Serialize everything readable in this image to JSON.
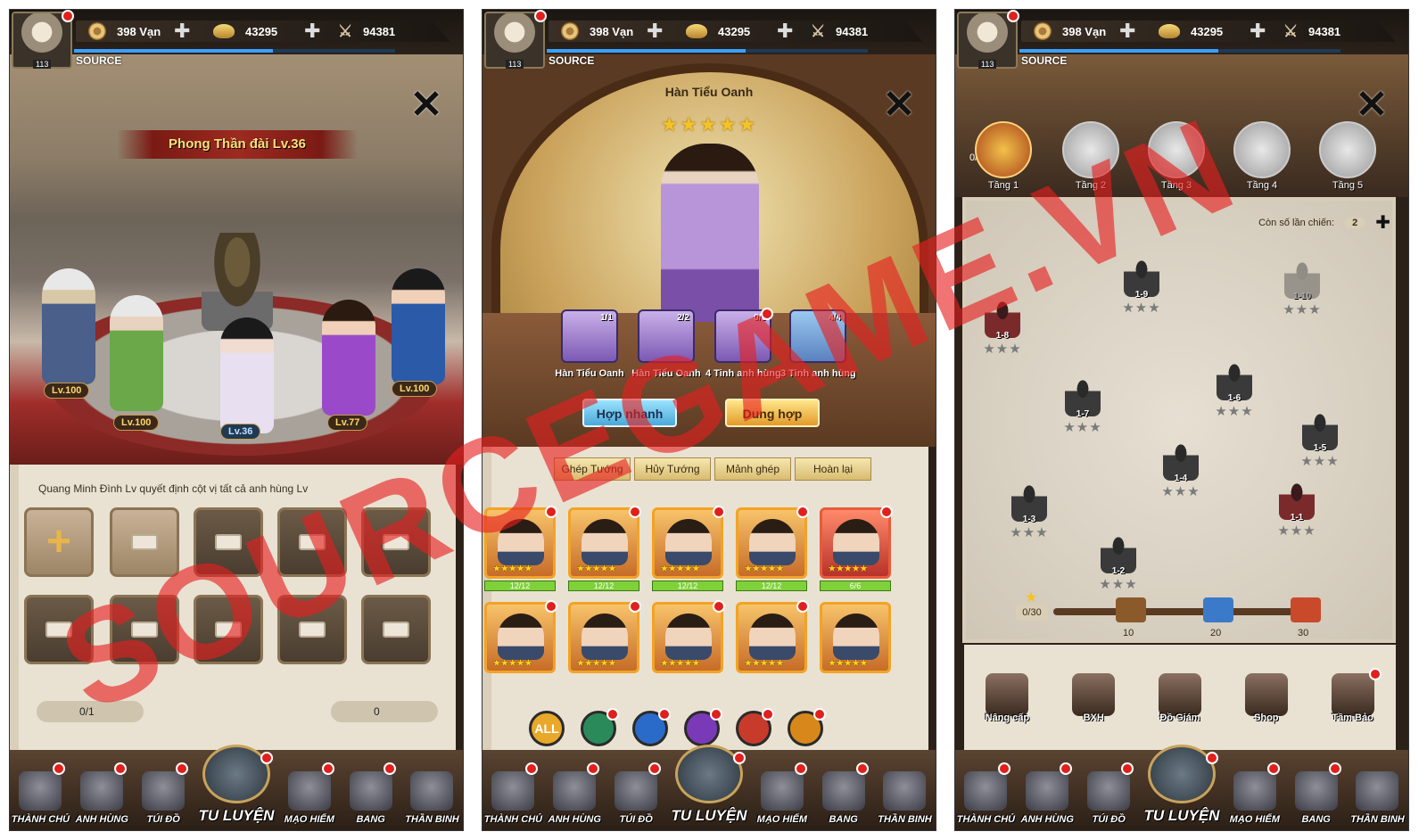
{
  "resources": {
    "copper": "398 Vạn",
    "gold": "43295",
    "power": "94381",
    "player_level": "113",
    "source_label": "SOURCE"
  },
  "nav": [
    {
      "label": "THÀNH CHỦ",
      "icon": "castle-icon"
    },
    {
      "label": "ANH HÙNG",
      "icon": "hat-icon"
    },
    {
      "label": "TÚI ĐỒ",
      "icon": "bag-icon"
    },
    {
      "label": "TU LUYỆN",
      "icon": "sword-icon"
    },
    {
      "label": "MẠO HIỂM",
      "icon": "scroll-map-icon"
    },
    {
      "label": "BANG",
      "icon": "banner-icon"
    },
    {
      "label": "THẦN BINH",
      "icon": "weapon-icon"
    }
  ],
  "panel1": {
    "title": "Phong Thần đài Lv.36",
    "levels": [
      "Lv.100",
      "Lv.100",
      "Lv.36",
      "Lv.77",
      "Lv.100"
    ],
    "note": "Quang Minh Đình Lv quyết định cột vị tất cả anh hùng Lv",
    "count_left": "0/1",
    "count_right": "0"
  },
  "panel2": {
    "hero_name": "Hàn Tiểu Oanh",
    "stars": "★★★★★",
    "materials": [
      {
        "count": "1/1",
        "name": "Hàn Tiểu Oanh"
      },
      {
        "count": "2/2",
        "name": "Hàn Tiểu Oanh"
      },
      {
        "count": "0/5",
        "name": "4 Tinh anh hùng"
      },
      {
        "count": "4/4",
        "name": "3 Tinh anh hùng"
      }
    ],
    "btn_quick": "Hợp nhanh",
    "btn_merge": "Dung hợp",
    "tabs": [
      "Ghép Tướng",
      "Hủy Tướng",
      "Mảnh ghép",
      "Hoàn lại"
    ],
    "card_counts": [
      "12/12",
      "12/12",
      "12/12",
      "12/12",
      "6/6"
    ],
    "card_stars": "★★★★★",
    "elements": [
      "ALL",
      "",
      "",
      "",
      "",
      ""
    ],
    "colors": {
      "blue_btn": "#4aa9d8",
      "gold_btn": "#e29b2a",
      "badge": "#e0201c"
    }
  },
  "panel3": {
    "stamina": "0/30",
    "floors": [
      "Tầng 1",
      "Tầng 2",
      "Tầng 3",
      "Tầng 4",
      "Tầng 5"
    ],
    "tries_label": "Còn số lần chiến:",
    "tries_value": "2",
    "nodes": [
      "1-1",
      "1-2",
      "1-3",
      "1-4",
      "1-5",
      "1-6",
      "1-7",
      "1-8",
      "1-9",
      "1-10"
    ],
    "node_stars": "★★★",
    "progress": "0/30",
    "chest_marks": [
      "10",
      "20",
      "30"
    ],
    "tools": [
      "Nâng cấp",
      "BXH",
      "Đồ Giám",
      "Shop",
      "Tầm Bảo"
    ]
  },
  "watermark": "SOURCEGAME.VN"
}
